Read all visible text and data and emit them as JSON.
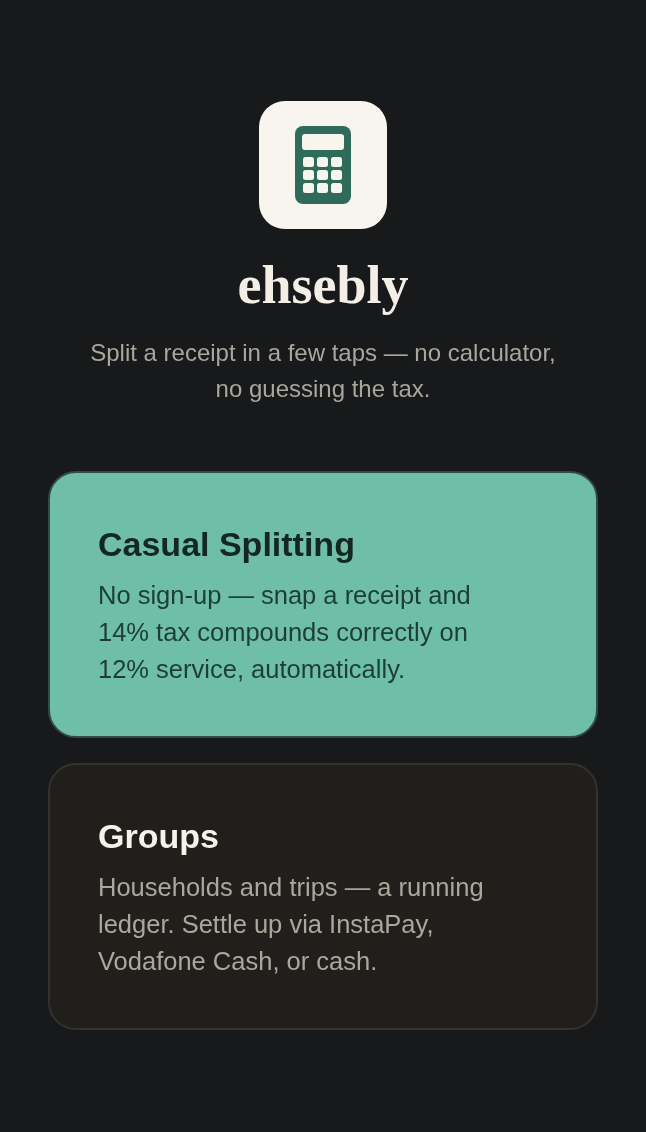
{
  "app": {
    "name": "ehsebly",
    "tagline": "Split a receipt in a few taps — no calculator, no guessing the tax."
  },
  "options": [
    {
      "title": "Casual Splitting",
      "description": "No sign-up — snap a receipt and 14% tax compounds correctly on 12% service, automatically.",
      "selected": true
    },
    {
      "title": "Groups",
      "description": "Households and trips — a running ledger. Settle up via InstaPay, Vodafone Cash, or cash.",
      "selected": false
    }
  ]
}
